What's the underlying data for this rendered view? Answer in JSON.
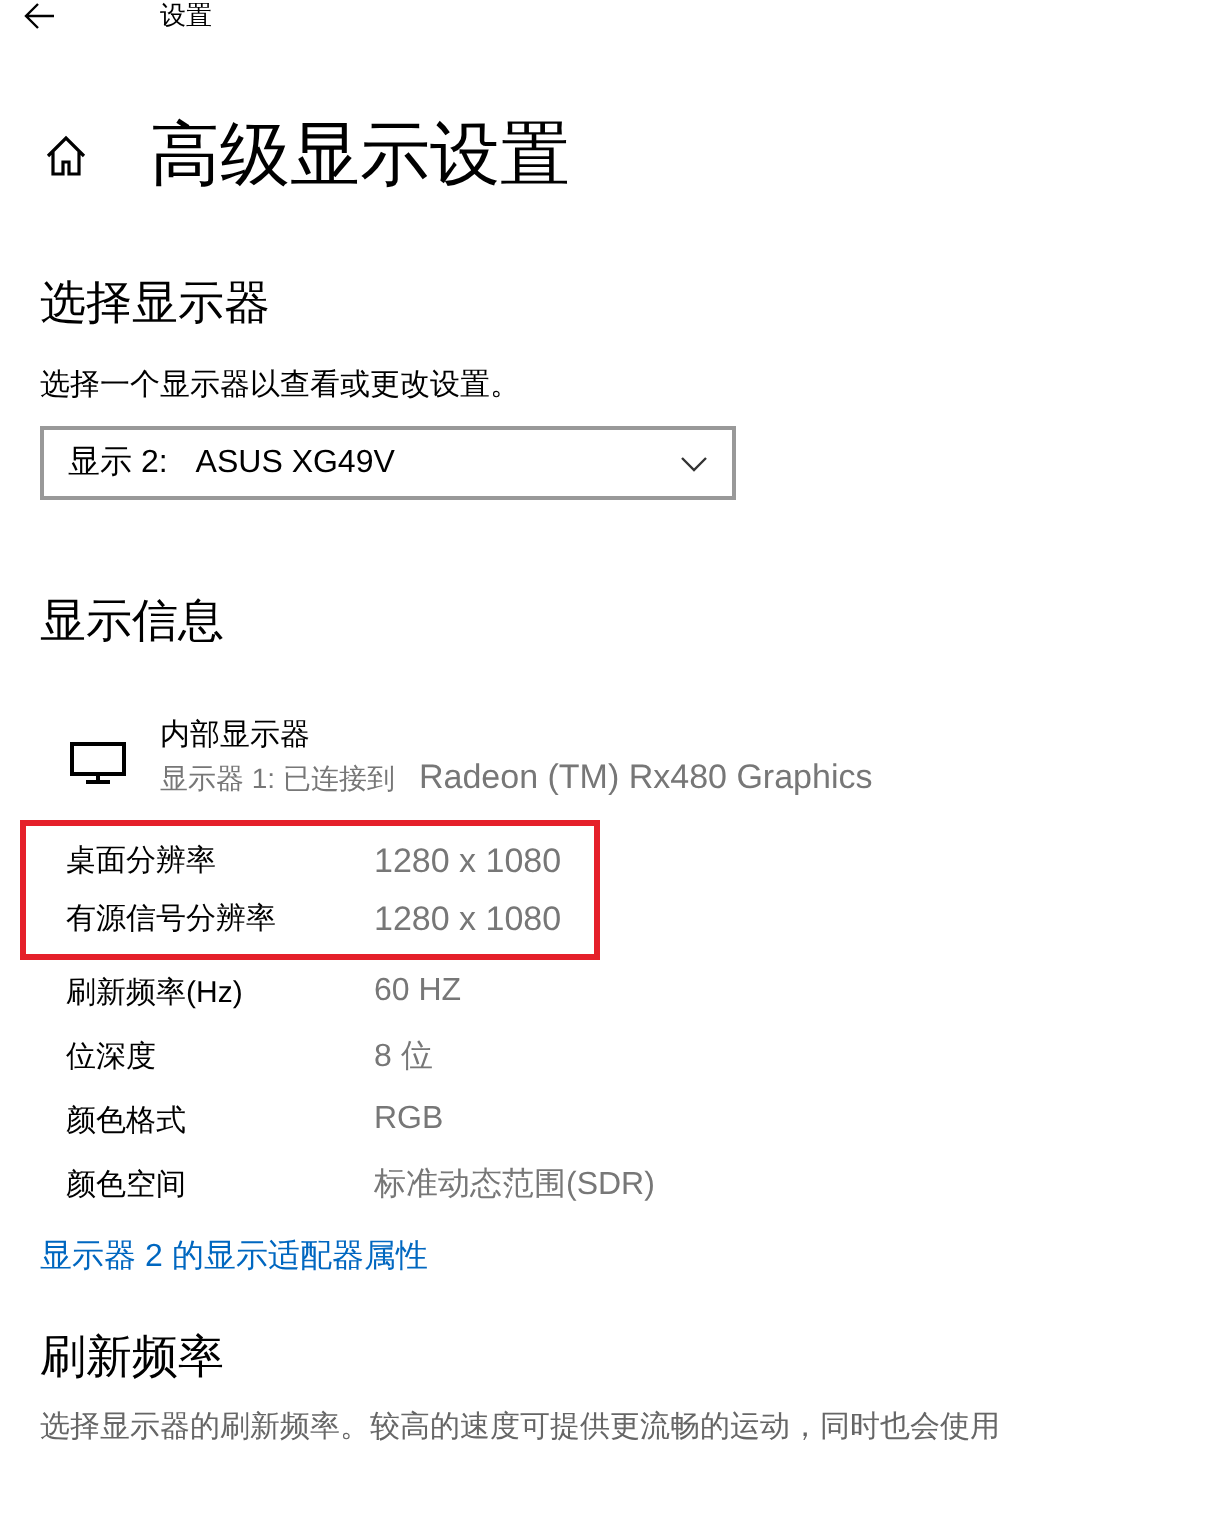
{
  "header": {
    "title": "设置"
  },
  "page": {
    "title": "高级显示设置"
  },
  "select_display": {
    "heading": "选择显示器",
    "description": "选择一个显示器以查看或更改设置。",
    "dropdown": {
      "prefix": "显示 2:",
      "value": "ASUS XG49V"
    }
  },
  "display_info": {
    "heading": "显示信息",
    "monitor": {
      "name": "内部显示器",
      "connection": "显示器 1: 已连接到",
      "adapter": "Radeon (TM) Rx480 Graphics"
    },
    "rows": [
      {
        "label": "桌面分辨率",
        "value": "1280 x 1080",
        "highlighted": true
      },
      {
        "label": "有源信号分辨率",
        "value": "1280 x 1080",
        "highlighted": true
      },
      {
        "label": "刷新频率(Hz)",
        "value": "60 HZ",
        "highlighted": false
      },
      {
        "label": "位深度",
        "value": "8 位",
        "highlighted": false
      },
      {
        "label": "颜色格式",
        "value": "RGB",
        "highlighted": false
      },
      {
        "label": "颜色空间",
        "value": "标准动态范围(SDR)",
        "highlighted": false
      }
    ],
    "link": "显示器 2 的显示适配器属性"
  },
  "refresh_rate": {
    "heading": "刷新频率",
    "description": "选择显示器的刷新频率。较高的速度可提供更流畅的运动，同时也会使用"
  }
}
